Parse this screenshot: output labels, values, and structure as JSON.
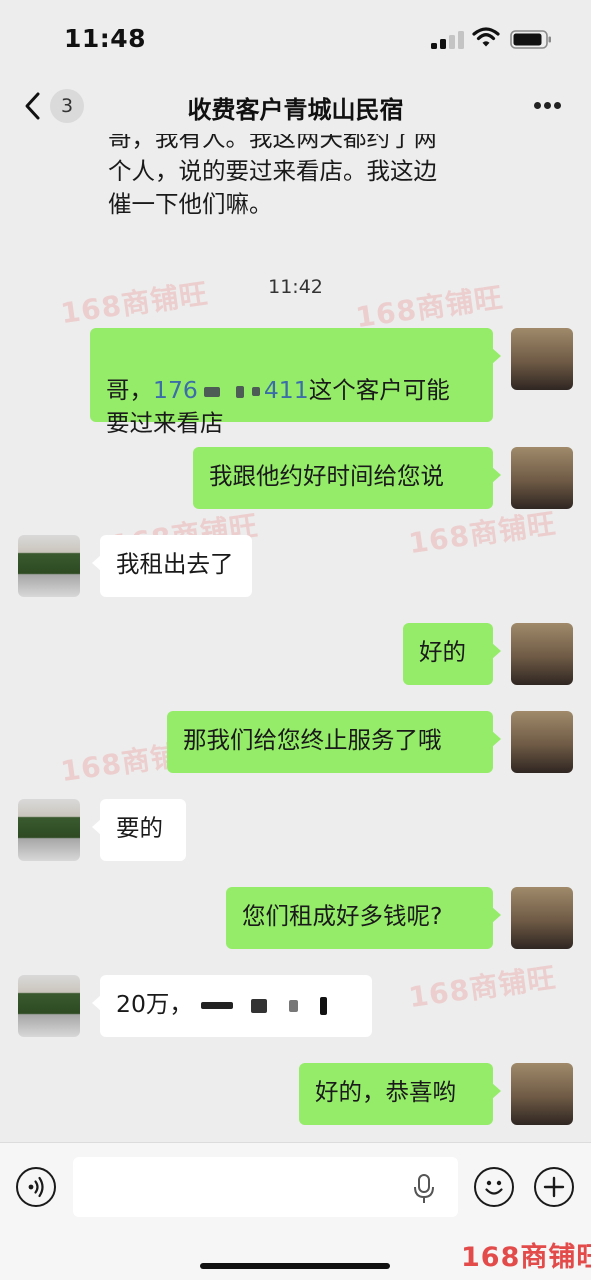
{
  "status_bar": {
    "time": "11:48"
  },
  "nav": {
    "unread_count": "3",
    "title": "收费客户青城山民宿"
  },
  "chat": {
    "partial_message": "哥，我有人。我这两天都约了两\n个人，说的要过来看店。我这边\n催一下他们嘛。",
    "time_divider": "11:42",
    "messages": [
      {
        "sender": "self",
        "prefix": "哥，",
        "phone": "176",
        "phone_suffix": "411",
        "suffix": "这个客户可能\n要过来看店"
      },
      {
        "sender": "self",
        "text": "我跟他约好时间给您说"
      },
      {
        "sender": "other",
        "text": "我租出去了"
      },
      {
        "sender": "self",
        "text": "好的"
      },
      {
        "sender": "self",
        "text": "那我们给您终止服务了哦"
      },
      {
        "sender": "other",
        "text": "要的"
      },
      {
        "sender": "self",
        "text": "您们租成好多钱呢?"
      },
      {
        "sender": "other",
        "text": "20万，"
      },
      {
        "sender": "self",
        "text": "好的，恭喜哟"
      }
    ]
  },
  "watermark": "168商铺旺",
  "input_bar": {
    "placeholder": ""
  },
  "colors": {
    "self_bubble": "#95ec69",
    "other_bubble": "#ffffff",
    "background": "#ededed",
    "watermark": "#e34b4b"
  }
}
